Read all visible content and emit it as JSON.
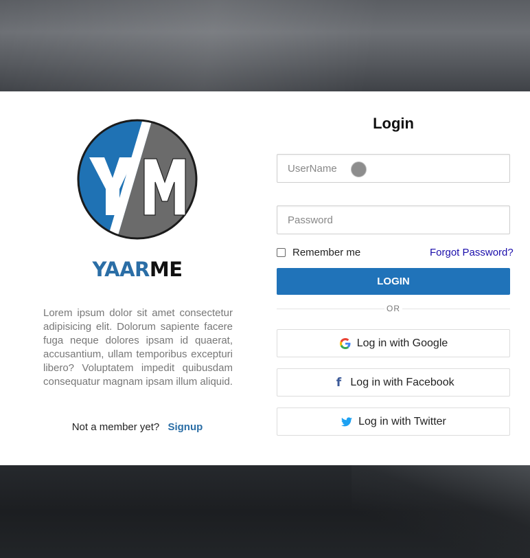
{
  "brand": {
    "part1": "YAAR",
    "part2": "ME",
    "logo_initials": "YM"
  },
  "description": "Lorem ipsum dolor sit amet consectetur adipisicing elit. Dolorum sapiente facere fuga neque dolores ipsam id quaerat, accusantium, ullam temporibus excepturi libero? Voluptatem impedit quibusdam consequatur magnam ipsam illum aliquid.",
  "member": {
    "text": "Not a member yet?",
    "signup_label": "Signup"
  },
  "login": {
    "title": "Login",
    "username_placeholder": "UserName",
    "username_value": "",
    "password_placeholder": "Password",
    "password_value": "",
    "remember_label": "Remember me",
    "remember_checked": false,
    "forgot_label": "Forgot Password?",
    "submit_label": "LOGIN",
    "divider_label": "OR"
  },
  "social": [
    {
      "label": "Log in with Google",
      "icon": "google-icon"
    },
    {
      "label": "Log in with Facebook",
      "icon": "facebook-icon"
    },
    {
      "label": "Log in with Twitter",
      "icon": "twitter-icon"
    }
  ],
  "colors": {
    "accent": "#2073b9",
    "brand_blue": "#2b6ea6",
    "logo_gray": "#6b6b6b",
    "forgot_link": "#1a0dab"
  }
}
